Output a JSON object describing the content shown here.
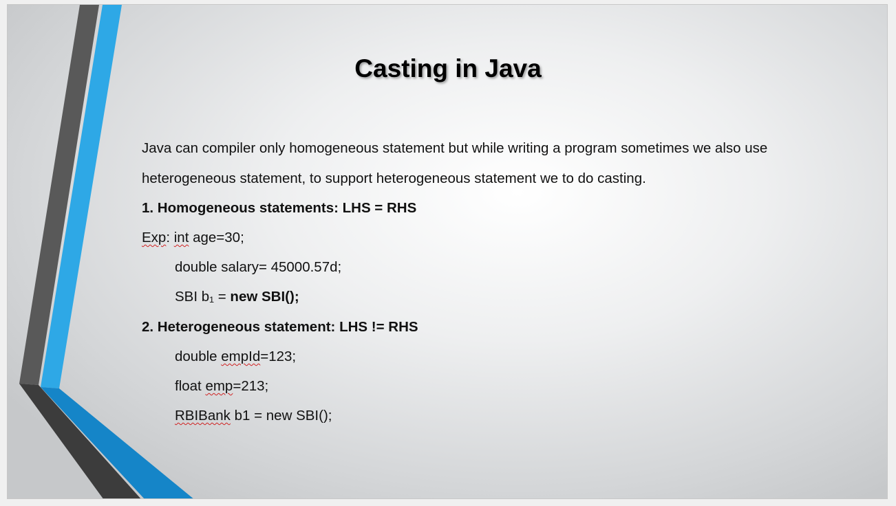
{
  "slide": {
    "title": "Casting in Java",
    "intro_line1": "Java can compiler only homogeneous statement but while writing a program sometimes we also use",
    "intro_line2": "heterogeneous statement, to support heterogeneous statement we to do casting.",
    "section1": "1. Homogeneous statements:  LHS = RHS",
    "exp_label": "Exp",
    "exp_colon": ": ",
    "exp_int": "int",
    "exp_rest": " age=30;",
    "line_salary": "double salary= 45000.57d;",
    "sbi_plain": "SBI b₁ = ",
    "sbi_bold": "new SBI();",
    "section2": "2. Heterogeneous statement: LHS != RHS",
    "empid_a": "double ",
    "empid_b": "empId",
    "empid_c": "=123;",
    "emp_a": "float ",
    "emp_b": "emp",
    "emp_c": "=213;",
    "rbi_a": "RBIBank",
    "rbi_b": " b1 = new SBI();"
  },
  "colors": {
    "dark_stripe": "#595959",
    "blue_stripe": "#2ea8e6",
    "blue_dark": "#1585c8",
    "dark_bottom": "#3c3c3c"
  }
}
